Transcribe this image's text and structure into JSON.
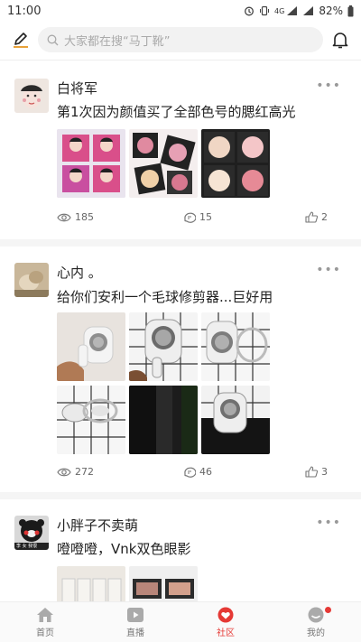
{
  "status": {
    "time": "11:00",
    "network": "4G",
    "battery": "82%"
  },
  "search": {
    "placeholder": "大家都在搜“马丁靴”"
  },
  "posts": [
    {
      "username": "白将军",
      "text": "第1次因为颜值买了全部色号的腮红高光",
      "views": "185",
      "comments": "15",
      "likes": "2"
    },
    {
      "username": "心内 。",
      "text": "给你们安利一个毛球修剪器...巨好用",
      "views": "272",
      "comments": "46",
      "likes": "3"
    },
    {
      "username": "小胖子不卖萌",
      "text": "噔噔噔，Vnk双色眼影",
      "avatar_caption": "李 女 我很"
    }
  ],
  "more_glyph": "•••",
  "nav": [
    {
      "label": "首页",
      "icon": "home-icon"
    },
    {
      "label": "直播",
      "icon": "live-icon"
    },
    {
      "label": "社区",
      "icon": "community-icon"
    },
    {
      "label": "我的",
      "icon": "profile-icon"
    }
  ],
  "colors": {
    "accent": "#e53935",
    "text": "#222222",
    "muted": "#999999"
  }
}
